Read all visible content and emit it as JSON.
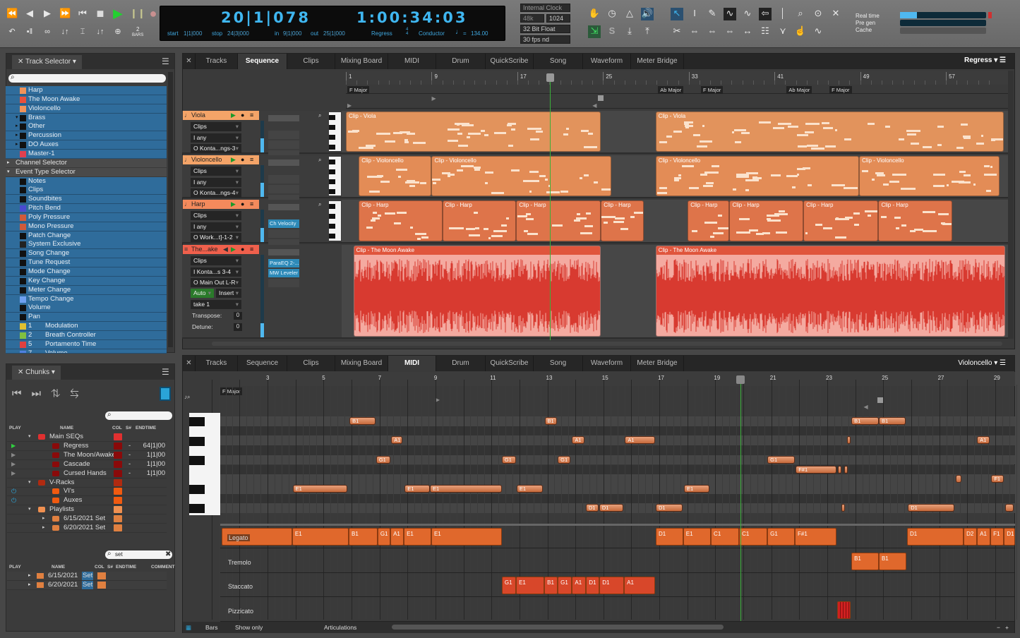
{
  "transport": {
    "buttons_row1": [
      "rewind-icon",
      "step-back-icon",
      "step-forward-icon",
      "fast-forward-icon",
      "return-to-start-icon",
      "stop-icon",
      "play-icon",
      "pause-icon",
      "record-icon"
    ],
    "buttons_row2": [
      "undo-icon",
      "memory-cycle-icon",
      "loop-icon",
      "auto-rewind-icon",
      "punch-icon",
      "auto-stop-icon",
      "countoff-icon"
    ],
    "countoff_num": "2",
    "countoff_label": "BARS",
    "counter": "20|1|078",
    "time": "1:00:34:03",
    "start_label": "start",
    "start": "1|1|000",
    "stop_label": "stop",
    "stop": "24|3|000",
    "in_label": "in",
    "in": "9|1|000",
    "out_label": "out",
    "out": "25|1|000",
    "sequence": "Regress",
    "meter_top": "4",
    "meter_bottom": "4",
    "conductor": "Conductor",
    "tempo_prefix": "=",
    "tempo": "134.00"
  },
  "audio": {
    "clock": "Internal Clock",
    "rate": "48k",
    "buffer": "1024",
    "bit_depth": "32 Bit Float",
    "frame_rate": "30 fps nd"
  },
  "tools": {
    "row1": [
      "metronome-hand-icon",
      "clock-icon",
      "metronome-icon",
      "speaker-icon",
      "arrow-tool-icon",
      "ibeam-tool-icon",
      "pencil-tool-icon",
      "reshape-tool-icon",
      "wave-tool-icon",
      "trim-tool-icon",
      "brush-tool-icon",
      "zoom-tool-icon",
      "scrub-tool-icon",
      "close-icon"
    ],
    "row2": [
      "input-routing-icon",
      "solo-icon",
      "import-icon",
      "export-icon",
      "scissors-icon",
      "split-icon",
      "merge-icon",
      "fit-icon",
      "spread-icon",
      "quantize-grid-icon",
      "filter-icon",
      "hand-tool-icon",
      "loop-wave-icon"
    ]
  },
  "performance": {
    "labels": [
      "Real time",
      "Pre gen",
      "Cache"
    ],
    "levels": [
      0.2,
      0,
      0
    ],
    "accent": "#4fb8ef"
  },
  "track_selector": {
    "title": "Track Selector",
    "tracks": [
      {
        "label": "Harp",
        "color": "#f0935a",
        "indent": 2
      },
      {
        "label": "The Moon Awake",
        "color": "#e8503c",
        "indent": 2
      },
      {
        "label": "Violoncello",
        "color": "#f0935a",
        "indent": 2
      },
      {
        "label": "Brass",
        "color": "#111111",
        "indent": 2
      },
      {
        "label": "Other",
        "color": "#111111",
        "indent": 2
      },
      {
        "label": "Percussion",
        "color": "#111111",
        "indent": 2
      },
      {
        "label": "DO Auxes",
        "color": "#111111",
        "indent": 2
      },
      {
        "label": "Master-1",
        "color": "#e04050",
        "indent": 2
      }
    ],
    "channel_selector": "Channel Selector",
    "event_type_selector": "Event Type Selector",
    "events": [
      {
        "label": "Notes",
        "color": "#111111"
      },
      {
        "label": "Clips",
        "color": "#111111"
      },
      {
        "label": "Soundbites",
        "color": "#111111"
      },
      {
        "label": "Pitch Bend",
        "color": "#4a4ad0"
      },
      {
        "label": "Poly Pressure",
        "color": "#d05a3a"
      },
      {
        "label": "Mono Pressure",
        "color": "#d05a3a"
      },
      {
        "label": "Patch Change",
        "color": "#111111"
      },
      {
        "label": "System Exclusive",
        "color": "#222222"
      },
      {
        "label": "Song Change",
        "color": "#111111"
      },
      {
        "label": "Tune Request",
        "color": "#111111"
      },
      {
        "label": "Mode Change",
        "color": "#111111"
      },
      {
        "label": "Key Change",
        "color": "#111111"
      },
      {
        "label": "Meter Change",
        "color": "#111111"
      },
      {
        "label": "Tempo Change",
        "color": "#6fa0f0"
      },
      {
        "label": "Volume",
        "color": "#111111"
      },
      {
        "label": "Pan",
        "color": "#111111"
      },
      {
        "label": "1",
        "name": "Modulation",
        "color": "#e0c030"
      },
      {
        "label": "2",
        "name": "Breath Controller",
        "color": "#80c040"
      },
      {
        "label": "5",
        "name": "Portamento Time",
        "color": "#e04040"
      },
      {
        "label": "7",
        "name": "Volume",
        "color": "#5080e0"
      }
    ]
  },
  "chunks": {
    "title": "Chunks",
    "buttons": [
      "prev-chunk-icon",
      "next-chunk-icon",
      "chain-icon",
      "chain-loop-icon",
      "layout-icon"
    ],
    "search_value": "",
    "columns": [
      "PLAY",
      "NAME",
      "COL",
      "S#",
      "ENDTIME"
    ],
    "rows": [
      {
        "name": "Main SEQs",
        "type": "folder",
        "indent": 0,
        "color": "#e03030",
        "play": "",
        "s": "",
        "end": ""
      },
      {
        "name": "Regress",
        "type": "seq",
        "indent": 1,
        "color": "#8a0a0a",
        "play": "playing",
        "s": "-",
        "end": "64|1|00"
      },
      {
        "name": "The Moon/Awake",
        "type": "seq",
        "indent": 1,
        "color": "#8a0a0a",
        "play": "play",
        "s": "-",
        "end": "1|1|00"
      },
      {
        "name": "Cascade",
        "type": "seq",
        "indent": 1,
        "color": "#8a0a0a",
        "play": "play",
        "s": "-",
        "end": "1|1|00"
      },
      {
        "name": "Cursed Hands",
        "type": "seq",
        "indent": 1,
        "color": "#8a0a0a",
        "play": "play",
        "s": "-",
        "end": "1|1|00"
      },
      {
        "name": "V-Racks",
        "type": "folder",
        "indent": 0,
        "color": "#b02a10",
        "play": "",
        "s": "",
        "end": ""
      },
      {
        "name": "VI's",
        "type": "rack",
        "indent": 1,
        "color": "#f05a10",
        "play": "power",
        "s": "",
        "end": ""
      },
      {
        "name": "Auxes",
        "type": "rack",
        "indent": 1,
        "color": "#f05a10",
        "play": "power",
        "s": "",
        "end": ""
      },
      {
        "name": "Playlists",
        "type": "folder",
        "indent": 0,
        "color": "#f09050",
        "play": "",
        "s": "",
        "end": ""
      },
      {
        "name": "6/15/2021 Set",
        "type": "set",
        "indent": 1,
        "color": "#e08040",
        "play": "",
        "s": "",
        "end": ""
      },
      {
        "name": "6/20/2021 Set",
        "type": "set",
        "indent": 1,
        "color": "#e08040",
        "play": "",
        "s": "",
        "end": ""
      }
    ],
    "search2_value": "set",
    "columns2": [
      "PLAY",
      "NAME",
      "COL",
      "S#",
      "ENDTIME",
      "COMMENT"
    ],
    "rows2": [
      {
        "name": "6/15/2021",
        "match": "Set",
        "color": "#e08040"
      },
      {
        "name": "6/20/2021",
        "match": "Set",
        "color": "#e08040"
      }
    ]
  },
  "tabs": [
    "Tracks",
    "Sequence",
    "Clips",
    "Mixing Board",
    "MIDI",
    "Drum",
    "QuickScribe",
    "Song",
    "Waveform",
    "Meter Bridge"
  ],
  "sequence_editor": {
    "active_tab": "Sequence",
    "sequence_menu": "Regress",
    "ruler_labels": [
      1,
      9,
      17,
      25,
      33,
      41,
      49,
      57
    ],
    "playhead_bar": 20.04,
    "key_changes": [
      {
        "bar": 1,
        "label": "F Major"
      },
      {
        "bar": 30,
        "label": "Ab Major"
      },
      {
        "bar": 34,
        "label": "F Major"
      },
      {
        "bar": 42,
        "label": "Ab Major"
      },
      {
        "bar": 46,
        "label": "F Major"
      }
    ],
    "tracks": [
      {
        "name": "Viola",
        "color": "#f4a468",
        "clip_color": "#e2935c",
        "fields": [
          "Clips",
          "I any",
          "O Konta...ngs-3"
        ],
        "plugins": [],
        "type": "midi",
        "clips": [
          {
            "label": "Clip - Viola",
            "start": 1,
            "end": 24.8
          },
          {
            "label": "Clip - Viola",
            "start": 29.9,
            "end": 62.4
          }
        ]
      },
      {
        "name": "Violoncello",
        "color": "#f4a468",
        "clip_color": "#e38c56",
        "fields": [
          "Clips",
          "I any",
          "O Konta...ngs-4"
        ],
        "plugins": [],
        "type": "midi",
        "clips": [
          {
            "label": "Clip - Violoncello",
            "start": 2.2,
            "end": 9
          },
          {
            "label": "Clip - Violoncello",
            "start": 9,
            "end": 25.8
          },
          {
            "label": "Clip - Violoncello",
            "start": 29.9,
            "end": 48.9
          },
          {
            "label": "Clip - Violoncello",
            "start": 48.9,
            "end": 62
          }
        ]
      },
      {
        "name": "Harp",
        "color": "#f48a5c",
        "clip_color": "#de744a",
        "fields": [
          "Clips",
          "I any",
          "O Work...t]-1-2"
        ],
        "plugins": [
          "Ch Velocity"
        ],
        "type": "midi",
        "clips": [
          {
            "label": "Clip - Harp",
            "start": 2.2,
            "end": 10
          },
          {
            "label": "Clip - Harp",
            "start": 10,
            "end": 16.9
          },
          {
            "label": "Clip - Harp",
            "start": 16.9,
            "end": 24.8
          },
          {
            "label": "Clip - Harp",
            "start": 24.8,
            "end": 28.8
          },
          {
            "label": "Clip - Harp",
            "start": 32.9,
            "end": 36.8
          },
          {
            "label": "Clip - Harp",
            "start": 36.8,
            "end": 43.7
          },
          {
            "label": "Clip - Harp",
            "start": 43.7,
            "end": 50.7
          },
          {
            "label": "Clip - Harp",
            "start": 50.7,
            "end": 57.6
          }
        ]
      },
      {
        "name": "The...ake",
        "color": "#f0604c",
        "clip_color": "#e0553c",
        "fields": [
          "Clips",
          "I Konta...s 3-4",
          "O Main Out L-R"
        ],
        "automation": "Auto",
        "insert": "Insert",
        "take": "take 1",
        "transpose_label": "Transpose:",
        "transpose": "0",
        "detune_label": "Detune:",
        "detune": "0",
        "plugins": [
          "ParaEQ 2-...",
          "MW Leveler"
        ],
        "type": "audio",
        "clips": [
          {
            "label": "Clip - The Moon Awake",
            "start": 1.7,
            "end": 24.8
          },
          {
            "label": "Clip - The Moon Awake",
            "start": 29.9,
            "end": 62.5
          }
        ]
      }
    ]
  },
  "midi_editor": {
    "active_tab": "MIDI",
    "track_menu": "Violoncello",
    "key_label": "F Major",
    "ruler_labels": [
      3,
      5,
      7,
      9,
      11,
      13,
      15,
      17,
      19,
      21,
      23,
      25,
      27,
      29
    ],
    "playhead_bar": 19.9,
    "pitch_rows": [
      "B1",
      "A#1",
      "A1",
      "G#1",
      "G1",
      "F#1",
      "F1",
      "E1",
      "D#1",
      "D1"
    ],
    "notes": [
      {
        "p": "B1",
        "s": 5.93,
        "e": 6.86
      },
      {
        "p": "B1",
        "s": 12.9,
        "e": 13.35
      },
      {
        "p": "B1",
        "s": 23.86,
        "e": 24.84
      },
      {
        "p": "B1",
        "s": 24.84,
        "e": 25.8
      },
      {
        "p": "A1",
        "s": 7.42,
        "e": 7.82
      },
      {
        "p": "A1",
        "s": 13.88,
        "e": 14.33
      },
      {
        "p": "A1",
        "s": 15.77,
        "e": 16.85
      },
      {
        "p": "A1",
        "s": 23.7,
        "e": 23.8
      },
      {
        "p": "A1",
        "s": 28.35,
        "e": 28.8
      },
      {
        "p": "G1",
        "s": 6.88,
        "e": 7.39
      },
      {
        "p": "G1",
        "s": 11.37,
        "e": 11.88
      },
      {
        "p": "G1",
        "s": 13.37,
        "e": 13.83
      },
      {
        "p": "G1",
        "s": 20.86,
        "e": 21.84
      },
      {
        "p": "F#1",
        "s": 21.87,
        "e": 23.33
      },
      {
        "p": "F#1",
        "s": 23.37,
        "e": 23.45
      },
      {
        "p": "F#1",
        "s": 23.6,
        "e": 23.68
      },
      {
        "p": "F1",
        "s": 27.6,
        "e": 27.8
      },
      {
        "p": "F1",
        "s": 28.86,
        "e": 29.3
      },
      {
        "p": "E1",
        "s": 3.9,
        "e": 5.85
      },
      {
        "p": "E1",
        "s": 7.9,
        "e": 8.8
      },
      {
        "p": "E1",
        "s": 8.8,
        "e": 11.37
      },
      {
        "p": "E1",
        "s": 11.9,
        "e": 12.84
      },
      {
        "p": "E1",
        "s": 17.88,
        "e": 18.8
      },
      {
        "p": "D1",
        "s": 14.37,
        "e": 14.83
      },
      {
        "p": "D1",
        "s": 14.85,
        "e": 15.7
      },
      {
        "p": "D1",
        "s": 16.87,
        "e": 17.84
      },
      {
        "p": "D1",
        "s": 23.5,
        "e": 23.6
      },
      {
        "p": "D1",
        "s": 25.88,
        "e": 27.55
      },
      {
        "p": "D1",
        "s": 29.36,
        "e": 29.66
      }
    ],
    "articulations": [
      {
        "name": "Legato",
        "color": "#e0682c",
        "switches": [
          {
            "l": "",
            "s": 1.36,
            "e": 3.88
          },
          {
            "l": "E1",
            "s": 3.88,
            "e": 5.9
          },
          {
            "l": "B1",
            "s": 5.9,
            "e": 6.93
          },
          {
            "l": "G1",
            "s": 6.93,
            "e": 7.39
          },
          {
            "l": "A1",
            "s": 7.39,
            "e": 7.87
          },
          {
            "l": "E1",
            "s": 7.87,
            "e": 8.85
          },
          {
            "l": "E1",
            "s": 8.85,
            "e": 11.37
          },
          {
            "l": "D1",
            "s": 16.87,
            "e": 17.85
          },
          {
            "l": "E1",
            "s": 17.85,
            "e": 18.84
          },
          {
            "l": "C1",
            "s": 18.84,
            "e": 19.85
          },
          {
            "l": "C1",
            "s": 19.85,
            "e": 20.86
          },
          {
            "l": "G1",
            "s": 20.86,
            "e": 21.84
          },
          {
            "l": "F#1",
            "s": 21.84,
            "e": 23.33
          },
          {
            "l": "D1",
            "s": 25.85,
            "e": 27.87
          },
          {
            "l": "D2",
            "s": 27.87,
            "e": 28.35
          },
          {
            "l": "A1",
            "s": 28.35,
            "e": 28.83
          },
          {
            "l": "F1",
            "s": 28.83,
            "e": 29.31
          },
          {
            "l": "D1",
            "s": 29.31,
            "e": 29.71
          }
        ]
      },
      {
        "name": "Tremolo",
        "color": "#e0682c",
        "switches": [
          {
            "l": "B1",
            "s": 23.86,
            "e": 24.84
          },
          {
            "l": "B1",
            "s": 24.84,
            "e": 25.83
          }
        ]
      },
      {
        "name": "Staccato",
        "color": "#d8472a",
        "switches": [
          {
            "l": "G1",
            "s": 11.37,
            "e": 11.88
          },
          {
            "l": "E1",
            "s": 11.88,
            "e": 12.89
          },
          {
            "l": "B1",
            "s": 12.89,
            "e": 13.37
          },
          {
            "l": "G1",
            "s": 13.37,
            "e": 13.88
          },
          {
            "l": "A1",
            "s": 13.88,
            "e": 14.38
          },
          {
            "l": "D1",
            "s": 14.38,
            "e": 14.86
          },
          {
            "l": "D1",
            "s": 14.86,
            "e": 15.74
          },
          {
            "l": "A1",
            "s": 15.74,
            "e": 16.85
          }
        ]
      },
      {
        "name": "Pizzicato",
        "color": "#d02020",
        "switches": [
          {
            "l": "",
            "s": 23.36,
            "e": 23.84
          }
        ]
      }
    ],
    "footer": {
      "units": "Bars",
      "filter": "Show only",
      "lane": "Articulations"
    }
  }
}
